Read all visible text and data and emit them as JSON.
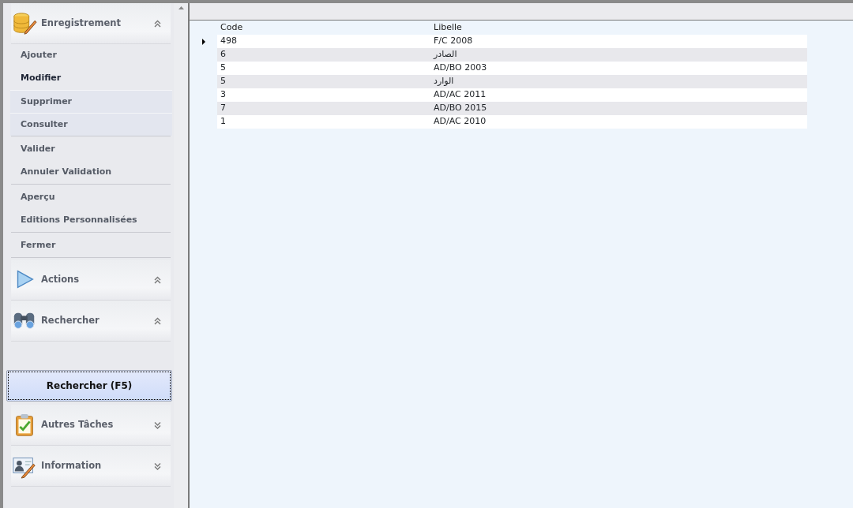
{
  "sidebar": {
    "groups": [
      {
        "title": "Enregistrement",
        "expanded": true,
        "sections": [
          [
            {
              "label": "Ajouter",
              "highlighted": false,
              "active": false
            },
            {
              "label": "Modifier",
              "highlighted": false,
              "active": true
            },
            {
              "label": "Supprimer",
              "highlighted": true,
              "active": false
            },
            {
              "label": "Consulter",
              "highlighted": true,
              "active": false
            }
          ],
          [
            {
              "label": "Valider",
              "highlighted": false,
              "active": false
            },
            {
              "label": "Annuler Validation",
              "highlighted": false,
              "active": false
            }
          ],
          [
            {
              "label": "Aperçu",
              "highlighted": false,
              "active": false
            },
            {
              "label": "Editions Personnalisées",
              "highlighted": false,
              "active": false
            }
          ],
          [
            {
              "label": "Fermer",
              "highlighted": false,
              "active": false
            }
          ]
        ]
      },
      {
        "title": "Actions",
        "expanded": true
      },
      {
        "title": "Rechercher",
        "expanded": true,
        "button": "Rechercher (F5)"
      },
      {
        "title": "Autres Tâches",
        "expanded": false
      },
      {
        "title": "Information",
        "expanded": false
      }
    ]
  },
  "table": {
    "columns": [
      "Code",
      "Libelle"
    ],
    "rows": [
      {
        "code": "498",
        "libelle": "F/C 2008",
        "selected": true
      },
      {
        "code": "6",
        "libelle": "الصادر",
        "selected": false
      },
      {
        "code": "5",
        "libelle": "AD/BO 2003",
        "selected": false
      },
      {
        "code": "5",
        "libelle": "الوارد",
        "selected": false
      },
      {
        "code": "3",
        "libelle": "AD/AC 2011",
        "selected": false
      },
      {
        "code": "7",
        "libelle": "AD/BO 2015",
        "selected": false
      },
      {
        "code": "1",
        "libelle": "AD/AC 2010",
        "selected": false
      }
    ]
  }
}
